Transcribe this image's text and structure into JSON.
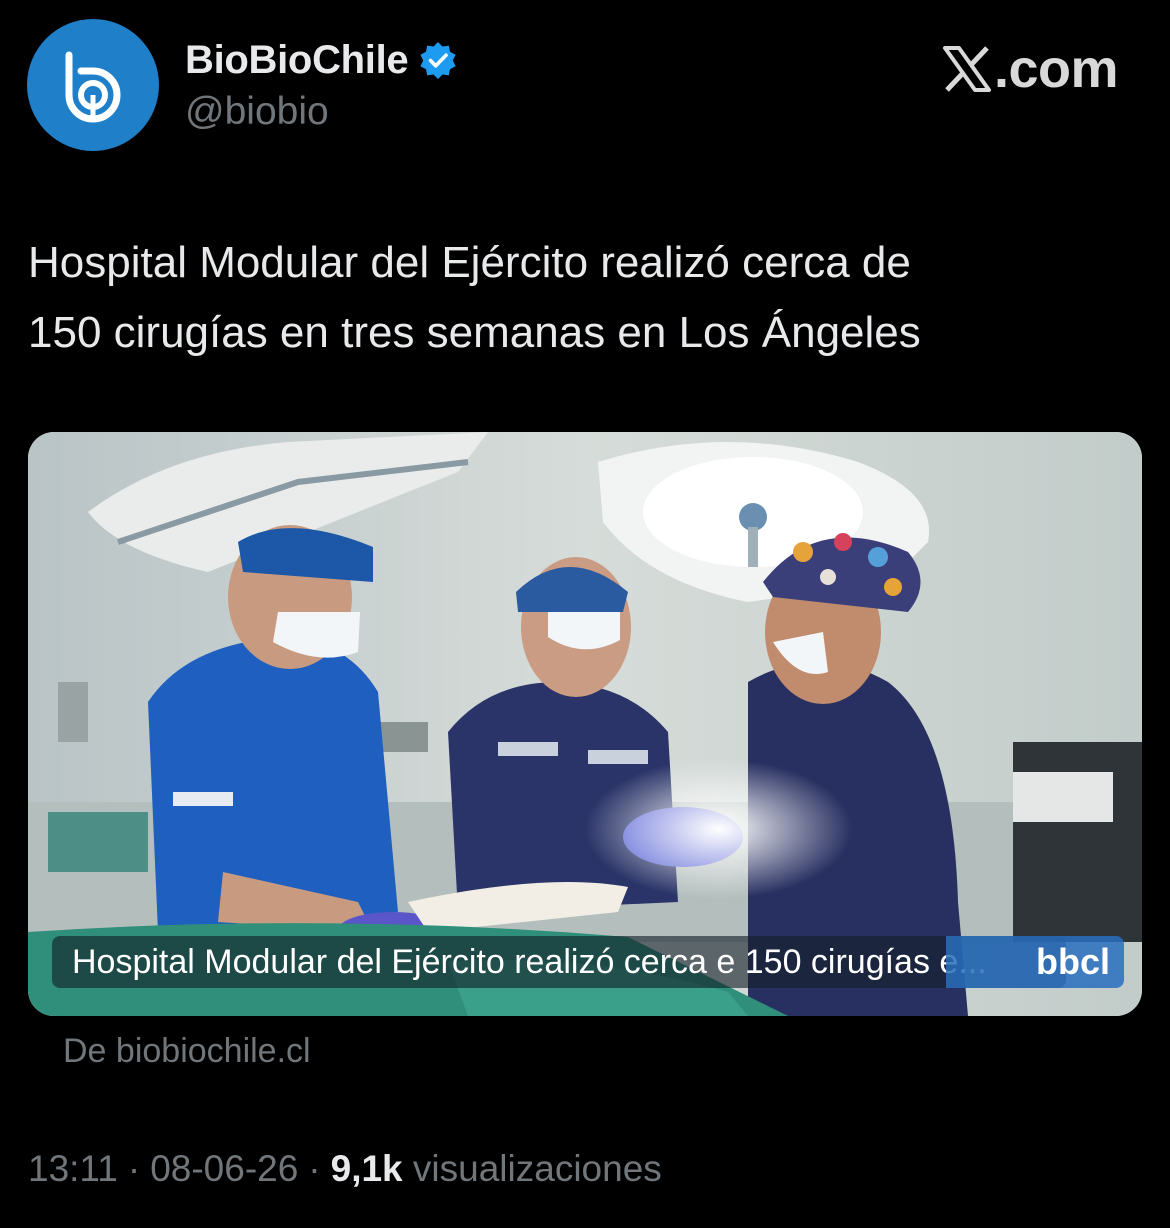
{
  "author": {
    "display_name": "BioBioChile",
    "handle": "@biobio",
    "verified": true,
    "avatar_color": "#1f7fc8"
  },
  "branding": {
    "site": ".com",
    "logo_icon": "x-logo-icon"
  },
  "tweet": {
    "text_line1": "Hospital Modular del Ejército realizó cerca de",
    "text_line2": "150 cirugías en tres semanas en Los Ángeles"
  },
  "link_card": {
    "caption": "Hospital Modular del Ejército realizó cerca e 150 cirugías e...",
    "logo_text": "bbcl",
    "source": "De biobiochile.cl",
    "image_icon": "surgery-photo"
  },
  "meta": {
    "time": "13:11",
    "date": "08-06-26",
    "views_count": "9,1k",
    "views_label": "visualizaciones",
    "separator": "·"
  },
  "colors": {
    "background": "#000000",
    "text_primary": "#e7e9ea",
    "text_secondary": "#71767b",
    "verified_blue": "#1d9bf0"
  }
}
